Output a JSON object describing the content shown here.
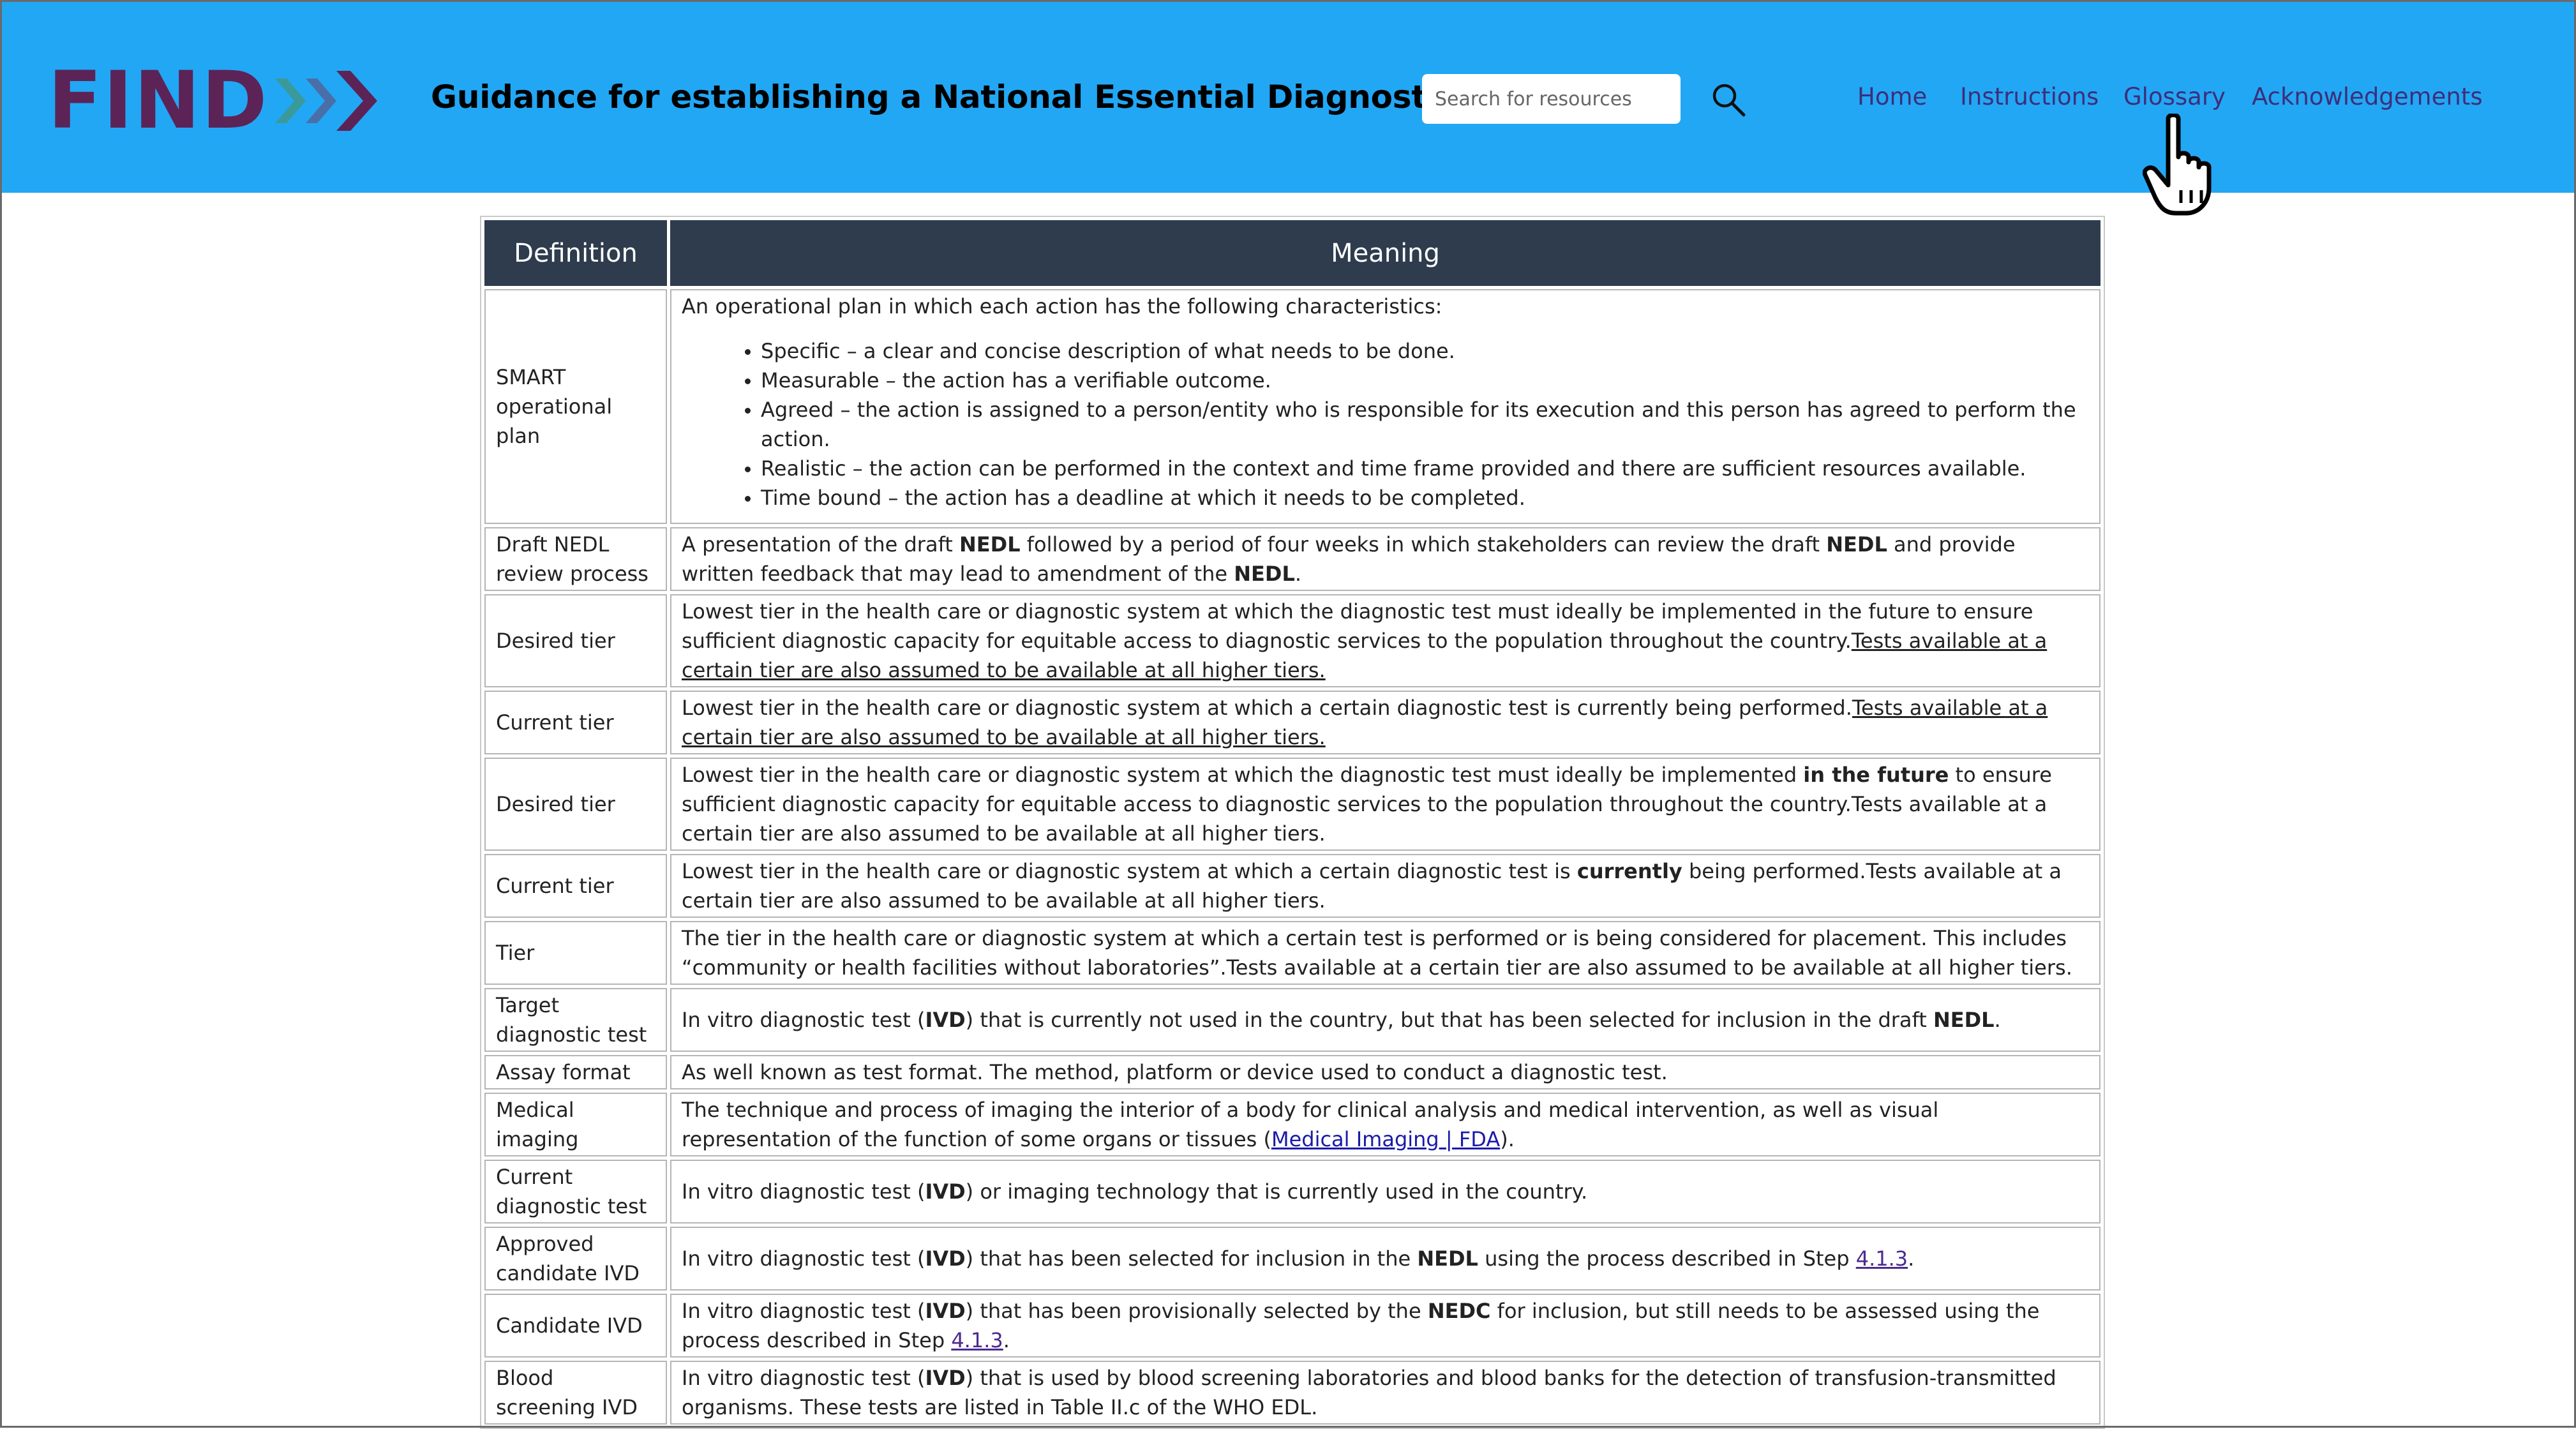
{
  "header": {
    "logo": "FIND",
    "title": "Guidance for establishing a National Essential Diagnostics List",
    "search_placeholder": "Search for resources",
    "nav": [
      "Home",
      "Instructions",
      "Glossary",
      "Acknowledgements"
    ]
  },
  "table": {
    "headers": [
      "Definition",
      "Meaning"
    ],
    "smart": {
      "term": "SMART operational plan",
      "intro": "An operational plan in which each action has the following characteristics:",
      "bullets": [
        "Specific – a clear and concise description of what needs to be done.",
        "Measurable – the action has a verifiable outcome.",
        "Agreed – the action is assigned to a person/entity who is responsible for its execution and this person has agreed to perform the action.",
        "Realistic – the action can be performed in the context and time frame provided and there are sufficient resources available.",
        "Time bound – the action has a deadline at which it needs to be completed."
      ]
    },
    "rows": [
      {
        "term": "Draft NEDL review process",
        "parts": [
          {
            "t": "A presentation of the draft "
          },
          {
            "t": "NEDL",
            "b": true
          },
          {
            "t": " followed by a period of four weeks in which stakeholders can review the draft "
          },
          {
            "t": "NEDL",
            "b": true
          },
          {
            "t": " and provide written feedback that may lead to amendment of the "
          },
          {
            "t": "NEDL",
            "b": true
          },
          {
            "t": "."
          }
        ]
      },
      {
        "term": "Desired tier",
        "parts": [
          {
            "t": "Lowest tier in the health care or diagnostic system at which the diagnostic test must ideally be implemented in the future to ensure sufficient diagnostic capacity for equitable access to diagnostic services to the population throughout the country."
          },
          {
            "t": "Tests available at a certain tier are also assumed to be available at all higher tiers.",
            "u": true
          }
        ]
      },
      {
        "term": "Current tier",
        "parts": [
          {
            "t": "Lowest tier in the health care or diagnostic system at which a certain diagnostic test is currently being performed."
          },
          {
            "t": "Tests available at a certain tier are also assumed to be available at all higher tiers.",
            "u": true
          }
        ]
      },
      {
        "term": "Desired tier",
        "parts": [
          {
            "t": "Lowest tier in the health care or diagnostic system at which the diagnostic test must ideally be implemented "
          },
          {
            "t": "in the future",
            "b": true
          },
          {
            "t": " to ensure sufficient diagnostic capacity for equitable access to diagnostic services to the population throughout the country.Tests available at a certain tier are also assumed to be available at all higher tiers."
          }
        ]
      },
      {
        "term": "Current tier",
        "parts": [
          {
            "t": "Lowest tier in the health care or diagnostic system at which a certain diagnostic test is "
          },
          {
            "t": "currently",
            "b": true
          },
          {
            "t": " being performed.Tests available at a certain tier are also assumed to be available at all higher tiers."
          }
        ]
      },
      {
        "term": "Tier",
        "parts": [
          {
            "t": "The tier in the health care or diagnostic system at which a certain test is performed or is being considered for placement. This includes “community or health facilities without laboratories”.Tests available at a certain tier are also assumed to be available at all higher tiers."
          }
        ]
      },
      {
        "term": "Target diagnostic test",
        "parts": [
          {
            "t": "In vitro diagnostic test ("
          },
          {
            "t": "IVD",
            "b": true
          },
          {
            "t": ") that is currently not used in the country, but that has been selected for inclusion in the draft "
          },
          {
            "t": "NEDL",
            "b": true
          },
          {
            "t": "."
          }
        ]
      },
      {
        "term": "Assay format",
        "parts": [
          {
            "t": "As well known as test format. The method, platform or device used to conduct a diagnostic test."
          }
        ]
      },
      {
        "term": "Medical imaging",
        "parts": [
          {
            "t": "The technique and process of imaging the interior of a body for clinical analysis and medical intervention, as well as visual representation of the function of some organs or tissues ("
          },
          {
            "t": "Medical Imaging | FDA",
            "link": true
          },
          {
            "t": ")."
          }
        ]
      },
      {
        "term": "Current diagnostic test",
        "parts": [
          {
            "t": "In vitro diagnostic test ("
          },
          {
            "t": "IVD",
            "b": true
          },
          {
            "t": ") or imaging technology that is currently used in the country."
          }
        ]
      },
      {
        "term": "Approved candidate IVD",
        "parts": [
          {
            "t": "In vitro diagnostic test ("
          },
          {
            "t": "IVD",
            "b": true
          },
          {
            "t": ") that has been selected for inclusion in the "
          },
          {
            "t": "NEDL",
            "b": true
          },
          {
            "t": " using the process described in Step "
          },
          {
            "t": "4.1.3",
            "link": true
          },
          {
            "t": "."
          }
        ]
      },
      {
        "term": "Candidate IVD",
        "parts": [
          {
            "t": "In vitro diagnostic test ("
          },
          {
            "t": "IVD",
            "b": true
          },
          {
            "t": ") that has been provisionally selected by the "
          },
          {
            "t": "NEDC",
            "b": true
          },
          {
            "t": " for inclusion, but still needs to be assessed using the process described in Step "
          },
          {
            "t": "4.1.3",
            "link": true
          },
          {
            "t": "."
          }
        ]
      },
      {
        "term": "Blood screening IVD",
        "parts": [
          {
            "t": "In vitro diagnostic test ("
          },
          {
            "t": "IVD",
            "b": true
          },
          {
            "t": ") that is used by blood screening laboratories and blood banks for the detection of transfusion-transmitted organisms. These tests are listed in Table II.c of the WHO EDL."
          }
        ]
      }
    ]
  }
}
